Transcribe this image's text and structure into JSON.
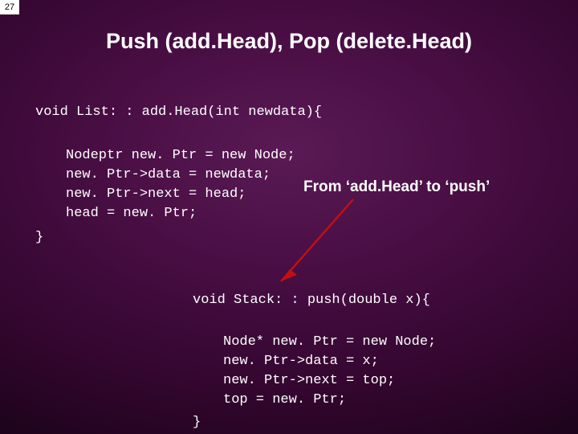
{
  "slide_number": "27",
  "title": "Push (add.Head), Pop (delete.Head)",
  "code1": {
    "signature": "void List: : add.Head(int newdata){",
    "body": "Nodeptr new. Ptr = new Node;\nnew. Ptr->data = newdata;\nnew. Ptr->next = head;\nhead = new. Ptr;",
    "close": "}"
  },
  "annotation": "From ‘add.Head’ to ‘push’",
  "code2": {
    "signature": "void Stack: : push(double x){",
    "body": "Node* new. Ptr = new Node;\nnew. Ptr->data = x;\nnew. Ptr->next = top;\ntop = new. Ptr;",
    "close": "}"
  }
}
